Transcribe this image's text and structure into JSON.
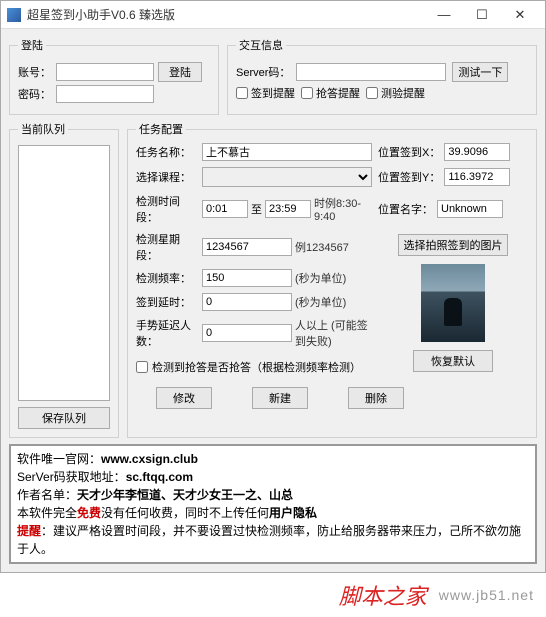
{
  "window": {
    "title": "超星签到小助手V0.6 臻选版"
  },
  "login": {
    "legend": "登陆",
    "account_lbl": "账号：",
    "password_lbl": "密码：",
    "login_btn": "登陆"
  },
  "interact": {
    "legend": "交互信息",
    "server_lbl": "Server码：",
    "test_btn": "测试一下",
    "cb_sign": "签到提醒",
    "cb_grab": "抢答提醒",
    "cb_test": "测验提醒"
  },
  "queue": {
    "legend": "当前队列",
    "save_btn": "保存队列"
  },
  "task": {
    "legend": "任务配置",
    "name_lbl": "任务名称：",
    "name_val": "上不慕古",
    "course_lbl": "选择课程：",
    "time_lbl": "检测时间段：",
    "time_start": "0:01",
    "time_mid": "至",
    "time_end": "23:59",
    "time_example": "时例8:30-9:40",
    "date_lbl": "检测星期段：",
    "date_val": "1234567",
    "date_example": "例1234567",
    "freq_lbl": "检测频率：",
    "freq_val": "150",
    "freq_unit": "(秒为单位)",
    "delay_lbl": "签到延时：",
    "delay_val": "0",
    "delay_unit": "(秒为单位)",
    "hand_lbl": "手势延迟人数：",
    "hand_val": "0",
    "hand_unit": "人以上 (可能签到失败)",
    "cb_detect": "检测到抢答是否抢答（根据检测频率检测）",
    "modify_btn": "修改",
    "new_btn": "新建",
    "delete_btn": "删除",
    "pos_x_lbl": "位置签到X：",
    "pos_x_val": "39.9096",
    "pos_y_lbl": "位置签到Y：",
    "pos_y_val": "116.3972",
    "pos_name_lbl": "位置名字：",
    "pos_name_val": "Unknown",
    "img_btn": "选择拍照签到的图片",
    "restore_btn": "恢复默认"
  },
  "info": {
    "l1a": "软件唯一官网：",
    "l1b": "www.cxsign.club",
    "l2a": "SerVer码获取地址：",
    "l2b": "sc.ftqq.com",
    "l3a": "作者名单：",
    "l3b": "天才少年李恒道、天才少女王一之、山总",
    "l4a": "本软件完全",
    "l4b": "免费",
    "l4c": "没有任何收费，同时不上传任何",
    "l4d": "用户隐私",
    "l5a": "提醒",
    "l5b": "：建议严格设置时间段，并不要设置过快检测频率，防止给服务器带来压力，己所不欲勿施于人。"
  },
  "footer": {
    "brand": "脚本之家",
    "url": "www.jb51.net"
  }
}
